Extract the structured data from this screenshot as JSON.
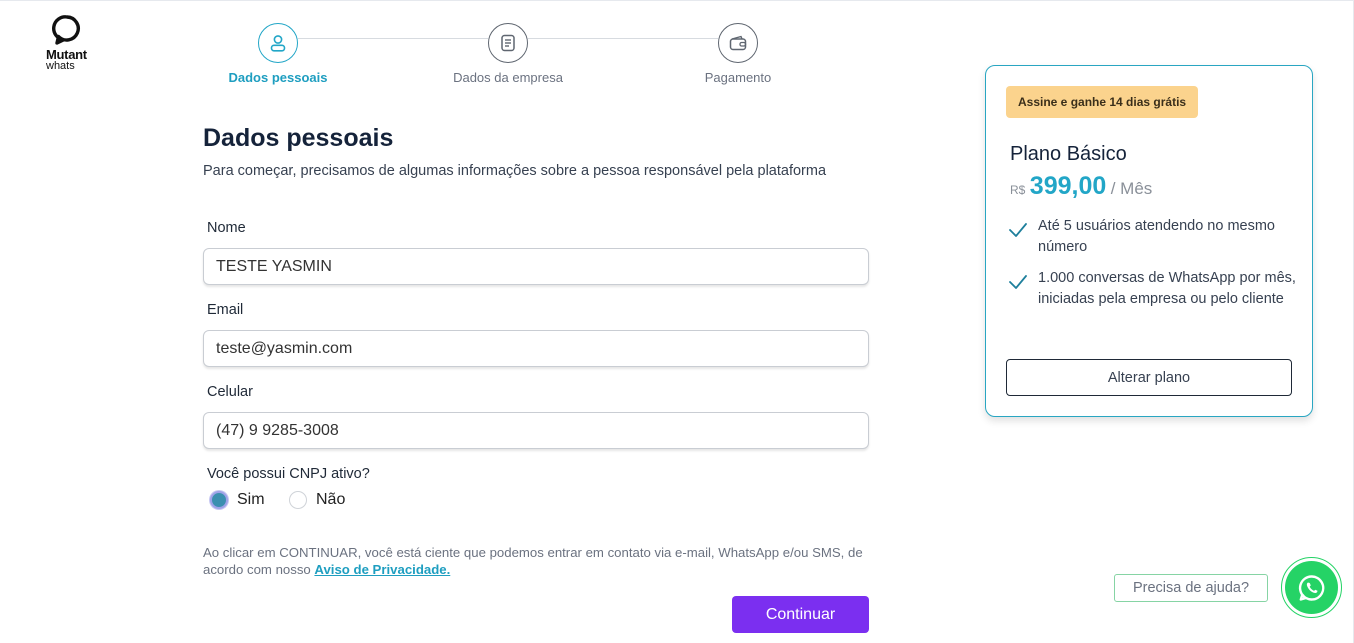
{
  "brand": {
    "line1": "Mutant",
    "line2": "whats"
  },
  "stepper": {
    "steps": [
      {
        "label": "Dados pessoais",
        "icon": "user-icon",
        "active": true
      },
      {
        "label": "Dados da empresa",
        "icon": "document-icon",
        "active": false
      },
      {
        "label": "Pagamento",
        "icon": "wallet-icon",
        "active": false
      }
    ]
  },
  "form": {
    "title": "Dados pessoais",
    "subtitle": "Para começar, precisamos de algumas informações sobre a pessoa responsável pela plataforma",
    "fields": {
      "name": {
        "label": "Nome",
        "value": "TESTE YASMIN"
      },
      "email": {
        "label": "Email",
        "value": "teste@yasmin.com"
      },
      "phone": {
        "label": "Celular",
        "value": "(47) 9 9285-3008"
      }
    },
    "cnpj": {
      "question": "Você possui CNPJ ativo?",
      "yes": "Sim",
      "no": "Não",
      "selected": "Sim"
    },
    "consent": {
      "text": "Ao clicar em CONTINUAR, você está ciente que podemos entrar em contato via e-mail, WhatsApp e/ou SMS, de acordo com nosso ",
      "link": "Aviso de Privacidade."
    },
    "continue_label": "Continuar"
  },
  "plan": {
    "badge": "Assine e ganhe 14 dias grátis",
    "name": "Plano Básico",
    "currency": "R$",
    "price": "399,00",
    "period": "/ Mês",
    "features": [
      "Até 5 usuários atendendo no mesmo número",
      "1.000 conversas de WhatsApp por mês, iniciadas pela empresa ou pelo cliente"
    ],
    "change_label": "Alterar plano"
  },
  "help": {
    "label": "Precisa de ajuda?"
  },
  "colors": {
    "accent": "#22a6c7",
    "primary_button": "#7b2ff0",
    "badge": "#fbd38d",
    "whatsapp": "#25d366"
  }
}
